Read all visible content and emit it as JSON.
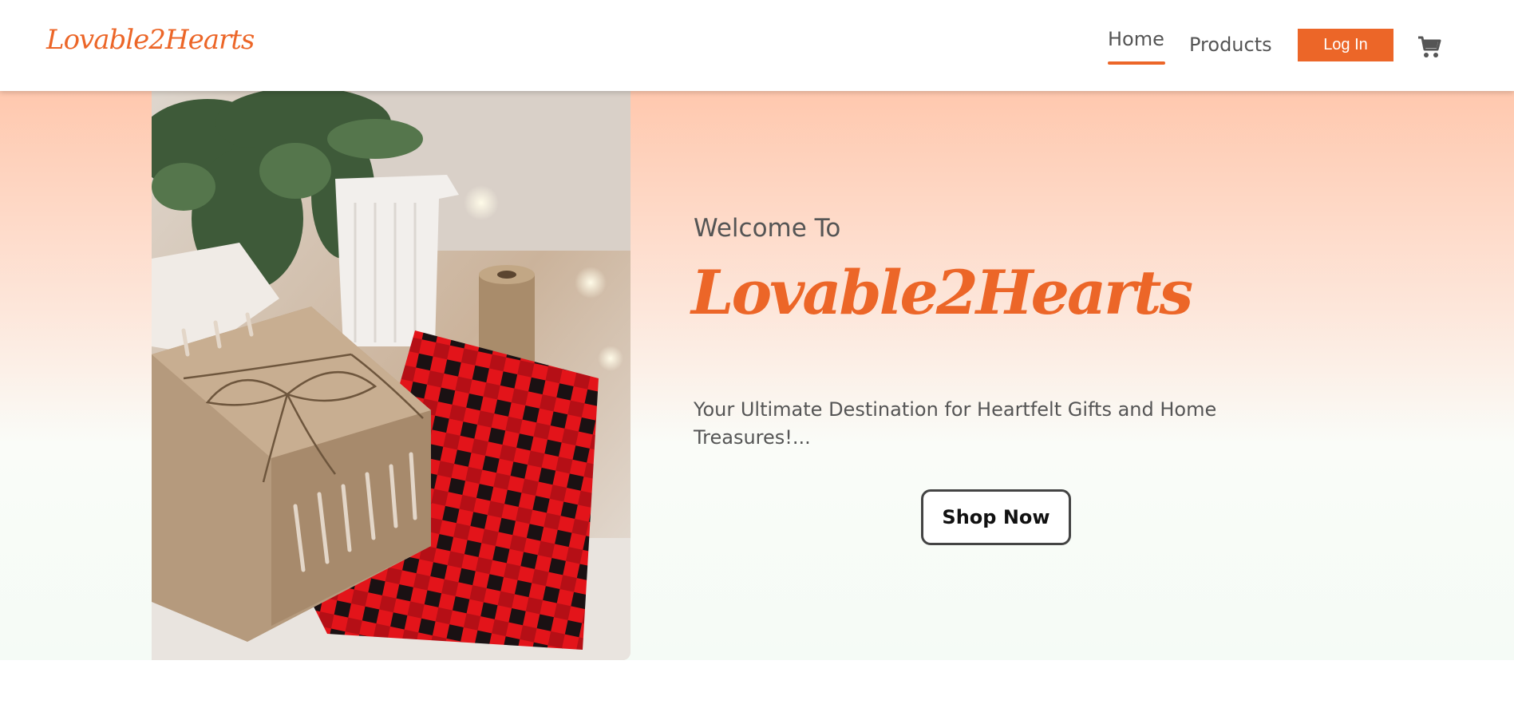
{
  "header": {
    "logo_text": "Lovable2Hearts",
    "nav": {
      "home_label": "Home",
      "products_label": "Products",
      "active": "Home"
    },
    "login_label": "Log In",
    "cart_icon": "shopping-cart-icon"
  },
  "hero": {
    "image_description": "gift-box-with-plaid-cloth-photo",
    "welcome_text": "Welcome To",
    "brand_text": "Lovable2Hearts",
    "tagline": "Your Ultimate Destination for Heartfelt Gifts and Home Treasures!...",
    "cta_label": "Shop Now"
  },
  "colors": {
    "accent": "#ec6628",
    "text_muted": "#555555",
    "hero_gradient_top": "#ffc8ae",
    "hero_gradient_bottom": "#f5fbf6"
  }
}
